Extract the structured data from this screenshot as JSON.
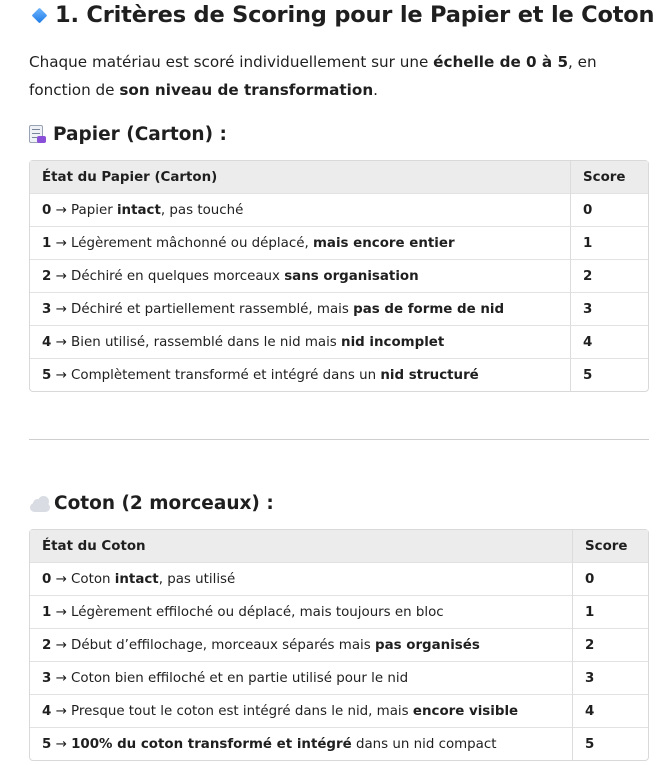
{
  "title": "1. Critères de Scoring pour le Papier et le Coton",
  "intro": {
    "p1": "Chaque matériau est scoré individuellement sur une ",
    "b1": "échelle de 0 à 5",
    "p2": ", en fonction de ",
    "b2": "son niveau de transformation",
    "p3": "."
  },
  "paper": {
    "heading": "Papier (Carton) :",
    "col_state": "État du Papier (Carton)",
    "col_score": "Score",
    "rows": [
      {
        "n": "0",
        "a": " → Papier ",
        "b": "intact",
        "c": ", pas touché",
        "score": "0"
      },
      {
        "n": "1",
        "a": " → Légèrement mâchonné ou déplacé, ",
        "b": "mais encore entier",
        "c": "",
        "score": "1"
      },
      {
        "n": "2",
        "a": " → Déchiré en quelques morceaux ",
        "b": "sans organisation",
        "c": "",
        "score": "2"
      },
      {
        "n": "3",
        "a": " → Déchiré et partiellement rassemblé, mais ",
        "b": "pas de forme de nid",
        "c": "",
        "score": "3"
      },
      {
        "n": "4",
        "a": " → Bien utilisé, rassemblé dans le nid mais ",
        "b": "nid incomplet",
        "c": "",
        "score": "4"
      },
      {
        "n": "5",
        "a": " → Complètement transformé et intégré dans un ",
        "b": "nid structuré",
        "c": "",
        "score": "5"
      }
    ]
  },
  "cotton": {
    "heading": "Coton (2 morceaux) :",
    "col_state": "État du Coton",
    "col_score": "Score",
    "rows": [
      {
        "n": "0",
        "a": " → Coton ",
        "b": "intact",
        "c": ", pas utilisé",
        "score": "0"
      },
      {
        "n": "1",
        "a": " → Légèrement effiloché ou déplacé, mais toujours en bloc",
        "b": "",
        "c": "",
        "score": "1"
      },
      {
        "n": "2",
        "a": " → Début d’effilochage, morceaux séparés mais ",
        "b": "pas organisés",
        "c": "",
        "score": "2"
      },
      {
        "n": "3",
        "a": " → Coton bien effiloché et en partie utilisé pour le nid",
        "b": "",
        "c": "",
        "score": "3"
      },
      {
        "n": "4",
        "a": " → Presque tout le coton est intégré dans le nid, mais ",
        "b": "encore visible",
        "c": "",
        "score": "4"
      },
      {
        "n": "5",
        "a": " → ",
        "b": "100% du coton transformé et intégré",
        "c": " dans un nid compact",
        "score": "5"
      }
    ]
  },
  "icons": {
    "title": "blue-diamond-icon",
    "paper": "document-icon",
    "cotton": "cloud-icon"
  }
}
